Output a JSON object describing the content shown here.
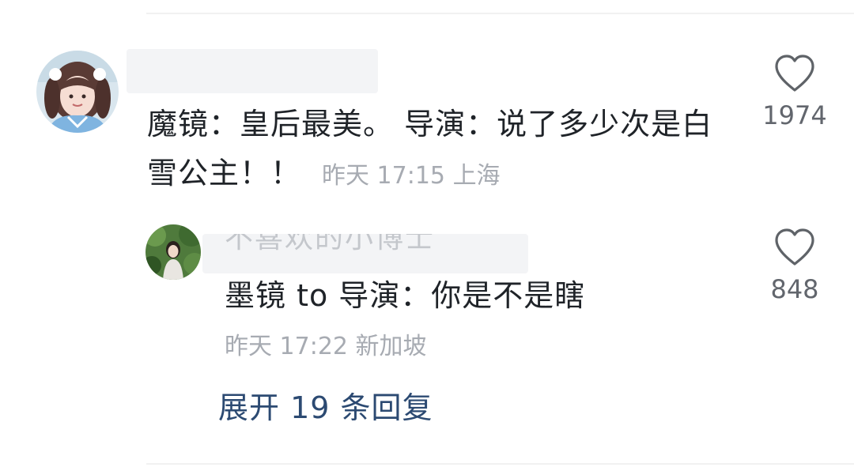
{
  "comment": {
    "text": "魔镜：皇后最美。 导演：说了多少次是白雪公主！！",
    "time": "昨天 17:15",
    "location": "上海",
    "likes": "1974",
    "heart_icon": "heart-outline-icon"
  },
  "reply": {
    "author_partial": "不喜欢的小博士",
    "text": "墨镜 to 导演：你是不是瞎",
    "time": "昨天 17:22",
    "location": "新加坡",
    "likes": "848",
    "heart_icon": "heart-outline-icon"
  },
  "expand_label": "展开 19 条回复",
  "colors": {
    "text": "#1f2328",
    "meta": "#a7abb2",
    "count": "#62666d",
    "link": "#2c4a72",
    "divider": "#f1f1f1"
  }
}
